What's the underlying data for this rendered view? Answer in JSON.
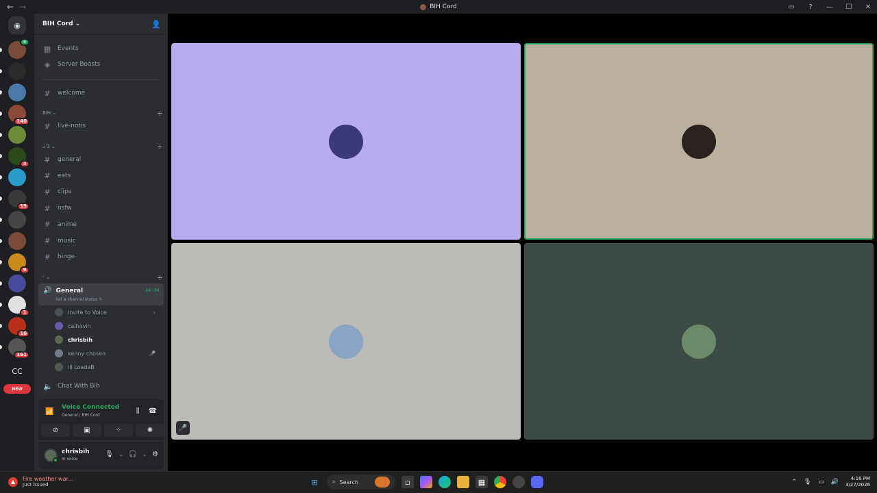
{
  "window": {
    "title": "BIH Cord",
    "back": "←",
    "forward": "→"
  },
  "server": {
    "name": "BIH Cord",
    "chevron": "⌄",
    "invite_icon": "person-add-icon"
  },
  "nav_items": [
    {
      "label": "Events",
      "icon": "calendar-icon"
    },
    {
      "label": "Server Boosts",
      "icon": "boost-icon"
    },
    {
      "label": "welcome",
      "icon": "hash-icon"
    }
  ],
  "categories": [
    {
      "label": "BIH ⌄",
      "channels": [
        "live-notis"
      ]
    },
    {
      "label": "ᒍ'3 ⌄",
      "channels": [
        "general",
        "eats",
        "clips",
        "nsfw",
        "anime",
        "music",
        "hinge"
      ]
    },
    {
      "label": "ᐟ ⌄",
      "channels": []
    }
  ],
  "voice_channel": {
    "name": "General",
    "timer": "34:04",
    "status_placeholder": "Set a channel status"
  },
  "voice_users": [
    {
      "name": "Invite to Voice",
      "color": "#4e5058",
      "tail": "›"
    },
    {
      "name": "calhavin",
      "color": "#6a5aa8",
      "tail": ""
    },
    {
      "name": "chrisbih",
      "color": "#5b6a55",
      "tail": ""
    },
    {
      "name": "kenny chosen",
      "color": "#6f7b8b",
      "tail": "🎤̸"
    },
    {
      "name": "ill LoadaB",
      "color": "#4e5a4f",
      "tail": ""
    }
  ],
  "other_voice_channel": "Chat With Bih",
  "voice_panel": {
    "title": "Voice Connected",
    "subtitle": "General / BIH Cord"
  },
  "user": {
    "name": "chrisbih",
    "status": "In voice"
  },
  "rail": {
    "home_icon": "discord-icon",
    "servers": [
      {
        "color": "#7a4b3a",
        "badge": "",
        "gbadge": "+"
      },
      {
        "color": "#2a2a2a",
        "badge": "",
        "gbadge": ""
      },
      {
        "color": "#4a7aa8",
        "badge": "",
        "gbadge": ""
      },
      {
        "color": "#8a4a35",
        "badge": "140",
        "gbadge": ""
      },
      {
        "color": "#6a8a3a",
        "badge": "",
        "gbadge": ""
      },
      {
        "color": "#2a4a1a",
        "badge": "3",
        "gbadge": ""
      },
      {
        "color": "#2a9ac8",
        "badge": "",
        "gbadge": ""
      },
      {
        "color": "#3a3a3a",
        "badge": "19",
        "gbadge": ""
      },
      {
        "color": "#444444",
        "badge": "",
        "gbadge": ""
      },
      {
        "color": "#7a4a3a",
        "badge": "",
        "gbadge": ""
      },
      {
        "color": "#c88a1a",
        "badge": "9",
        "gbadge": ""
      },
      {
        "color": "#4a4a9a",
        "badge": "",
        "gbadge": ""
      },
      {
        "color": "#e0e0e0",
        "badge": "1",
        "gbadge": ""
      },
      {
        "color": "#b8301a",
        "badge": "16",
        "gbadge": ""
      },
      {
        "color": "#555555",
        "badge": "161",
        "gbadge": ""
      }
    ],
    "cc_label": "CC",
    "new_label": "NEW"
  },
  "tiles": [
    {
      "bg": "#b8acf0",
      "pfp": "#3a3a7a",
      "speaking": false
    },
    {
      "bg": "#bbb09d",
      "pfp": "#2a2220",
      "speaking": true
    },
    {
      "bg": "#bdbbb7",
      "pfp": "#8aa4c4",
      "speaking": false
    },
    {
      "bg": "#3d4944",
      "pfp": "#6a8a6a",
      "speaking": false
    }
  ],
  "taskbar": {
    "weather_title": "Fire weather war...",
    "weather_sub": "Just issued",
    "search_label": "Search",
    "time": "4:16 PM",
    "date": "3/27/2026"
  },
  "colors": {
    "accent_green": "#23a55a",
    "danger": "#f23f43"
  }
}
